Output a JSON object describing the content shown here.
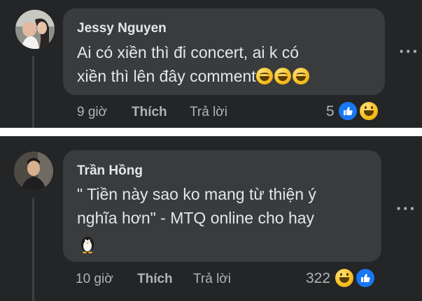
{
  "comments": [
    {
      "author": "Jessy Nguyen",
      "lines": [
        "Ai có xiền thì đi concert, ai k có",
        "xiền thì lên đây comment"
      ],
      "emojis": [
        "laughing-crying",
        "laughing-crying",
        "laughing-crying"
      ],
      "time": "9 giờ",
      "like_label": "Thích",
      "reply_label": "Trả lời",
      "reaction_count": "5",
      "reactions": [
        "like",
        "haha"
      ],
      "more": "···"
    },
    {
      "author": "Trần Hồng",
      "lines": [
        "\" Tiền này sao ko mang từ thiện ý",
        "nghĩa hơn\" - MTQ online cho hay"
      ],
      "emojis": [
        "penguin"
      ],
      "time": "10 giờ",
      "like_label": "Thích",
      "reply_label": "Trả lời",
      "reaction_count": "322",
      "reactions": [
        "haha",
        "like"
      ],
      "more": "···"
    }
  ],
  "colors": {
    "background": "#242526",
    "bubble": "#3a3b3c",
    "text_primary": "#e4e6eb",
    "text_secondary": "#b0b3b8",
    "like_blue": "#1877f2"
  }
}
